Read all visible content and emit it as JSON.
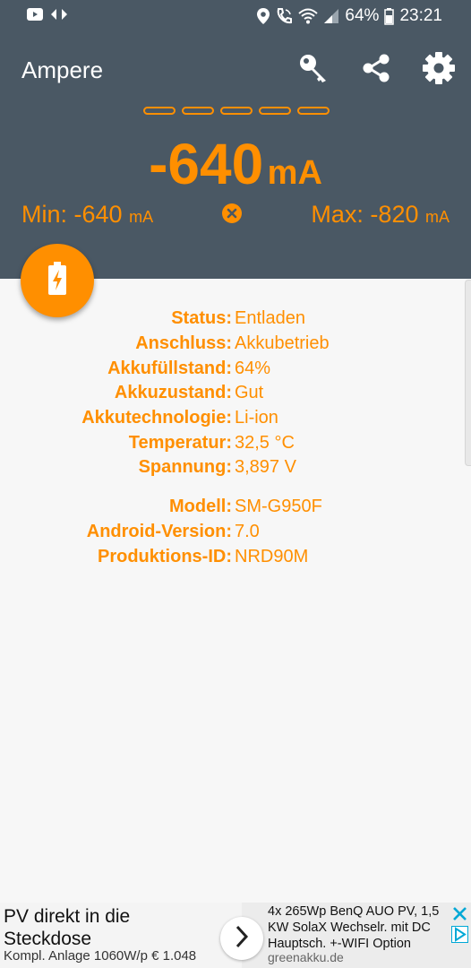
{
  "status_bar": {
    "battery": "64%",
    "time": "23:21"
  },
  "header": {
    "title": "Ampere",
    "current_value": "-640",
    "current_unit": "mA",
    "min_label": "Min: -640",
    "min_unit": "mA",
    "max_label": "Max: -820",
    "max_unit": "mA"
  },
  "info": [
    {
      "label": "Status:",
      "value": "Entladen"
    },
    {
      "label": "Anschluss:",
      "value": "Akkubetrieb"
    },
    {
      "label": "Akkufüllstand:",
      "value": "64%"
    },
    {
      "label": "Akkuzustand:",
      "value": "Gut"
    },
    {
      "label": "Akkutechnologie:",
      "value": "Li-ion"
    },
    {
      "label": "Temperatur:",
      "value": "32,5 °C"
    },
    {
      "label": "Spannung:",
      "value": "3,897 V"
    }
  ],
  "device": [
    {
      "label": "Modell:",
      "value": "SM-G950F"
    },
    {
      "label": "Android-Version:",
      "value": "7.0"
    },
    {
      "label": "Produktions-ID:",
      "value": "NRD90M"
    }
  ],
  "ad": {
    "title": "PV direkt in die Steckdose",
    "subtitle": "Kompl. Anlage 1060W/p € 1.048",
    "body": "4x 265Wp BenQ AUO PV, 1,5 KW SolaX Wechselr. mit DC Hauptsch. +-WIFI Option",
    "domain": "greenakku.de"
  },
  "colors": {
    "accent": "#ff8f00",
    "header_bg": "#4a5864"
  }
}
